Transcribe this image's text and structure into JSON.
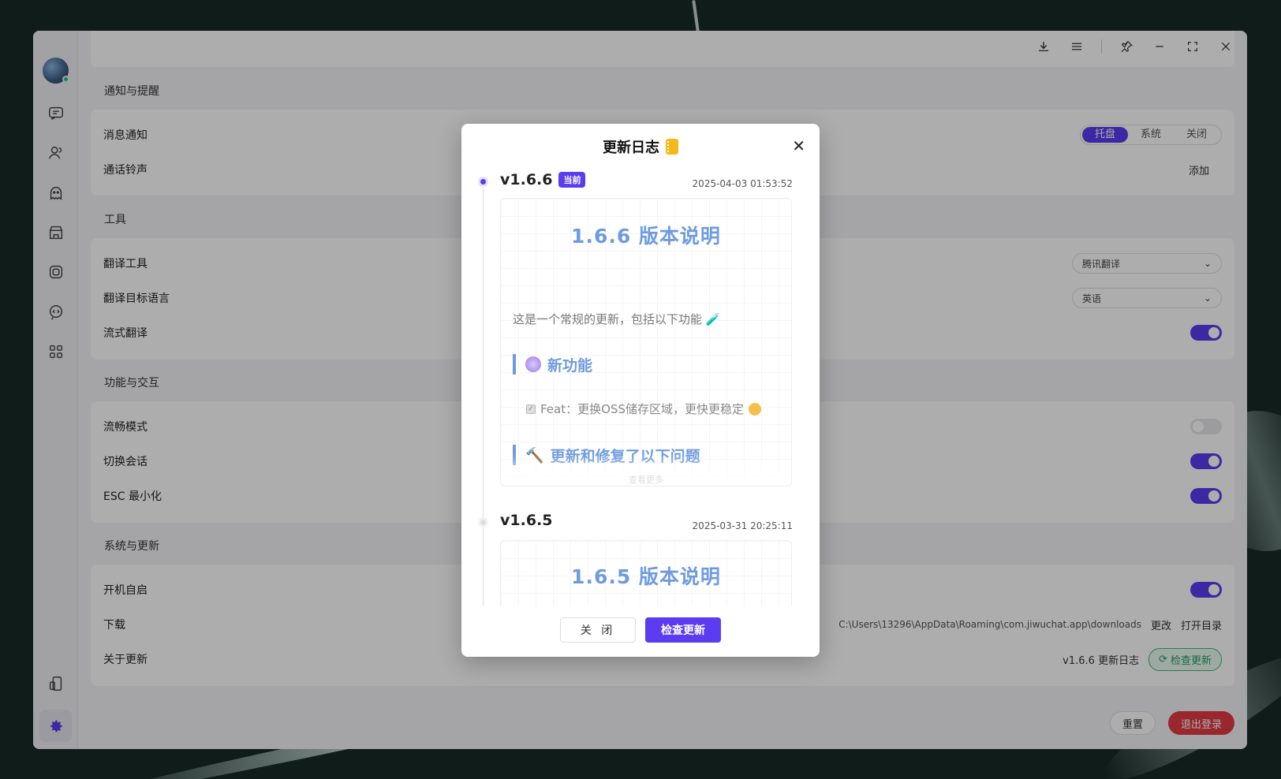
{
  "window": {
    "controls": [
      "download-icon",
      "menu-icon",
      "pin-icon",
      "minimize-icon",
      "maximize-icon",
      "close-icon"
    ]
  },
  "sections": {
    "notify": {
      "title": "通知与提醒",
      "message_label": "消息通知",
      "message_options": [
        "托盘",
        "系统",
        "关闭"
      ],
      "message_selected": "托盘",
      "ringtone_label": "通话铃声",
      "ringtone_action": "添加"
    },
    "tools": {
      "title": "工具",
      "translate_label": "翻译工具",
      "translate_value": "腾讯翻译",
      "target_lang_label": "翻译目标语言",
      "target_lang_value": "英语",
      "stream_label": "流式翻译",
      "stream_on": true
    },
    "interaction": {
      "title": "功能与交互",
      "smooth_label": "流畅模式",
      "smooth_on": false,
      "switch_label": "切换会话",
      "switch_on": true,
      "esc_label": "ESC 最小化",
      "esc_on": true
    },
    "system": {
      "title": "系统与更新",
      "autostart_label": "开机自启",
      "autostart_on": true,
      "download_label": "下载",
      "download_path": "C:\\Users\\13296\\AppData\\Roaming\\com.jiwuchat.app\\downloads",
      "download_change": "更改",
      "download_open": "打开目录",
      "about_label": "关于更新",
      "version_changelog": "v1.6.6 更新日志",
      "check_update": "检查更新"
    }
  },
  "footer": {
    "reset": "重置",
    "logout": "退出登录"
  },
  "modal": {
    "title": "更新日志",
    "entries": [
      {
        "version": "v1.6.6",
        "badge": "当前",
        "date": "2025-04-03 01:53:52",
        "note_title": "1.6.6 版本说明",
        "intro": "这是一个常规的更新，包括以下功能",
        "h_new": "新功能",
        "feat": "Feat：更换OSS储存区域，更快更稳定",
        "h_fix": "更新和修复了以下问题",
        "more": "查看更多"
      },
      {
        "version": "v1.6.5",
        "date": "2025-03-31 20:25:11",
        "note_title": "1.6.5 版本说明"
      }
    ],
    "close_btn": "关 闭",
    "check_btn": "检查更新"
  },
  "colors": {
    "accent": "#5b3cf0",
    "danger": "#e03a44",
    "success": "#1f9e5e",
    "note_blue": "#6e9be0"
  }
}
